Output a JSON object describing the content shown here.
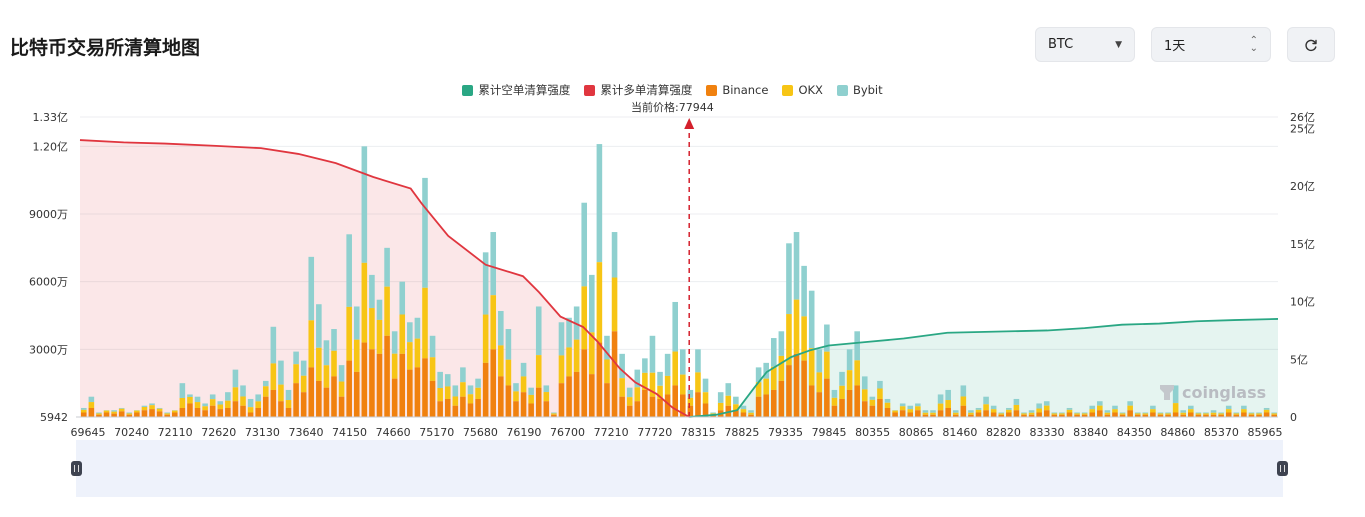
{
  "page": {
    "title": "比特币交易所清算地图",
    "coin_select": "BTC",
    "range_select": "1天",
    "refresh_icon": "refresh-icon"
  },
  "colors": {
    "short_cum": "#2aa784",
    "long_cum": "#e0363f",
    "binance": "#f0810f",
    "okx": "#f7c515",
    "bybit": "#8fd0cf"
  },
  "legend": [
    {
      "key": "short_cum",
      "label": "累计空单清算强度"
    },
    {
      "key": "long_cum",
      "label": "累计多单清算强度"
    },
    {
      "key": "binance",
      "label": "Binance"
    },
    {
      "key": "okx",
      "label": "OKX"
    },
    {
      "key": "bybit",
      "label": "Bybit"
    }
  ],
  "current_price_label": "当前价格:77944",
  "watermark": "coinglass",
  "chart_data": {
    "type": "bar",
    "current_price": 77944,
    "x_range": [
      69645,
      85965
    ],
    "x_ticks": [
      "69645",
      "70240",
      "72110",
      "72620",
      "73130",
      "73640",
      "74150",
      "74660",
      "75170",
      "75680",
      "76190",
      "76700",
      "77210",
      "77720",
      "78315",
      "78825",
      "79335",
      "79845",
      "80355",
      "80865",
      "81460",
      "82820",
      "83330",
      "83840",
      "84350",
      "84860",
      "85370",
      "85965"
    ],
    "y_left_ticks": [
      {
        "label": "5942",
        "value": 0
      },
      {
        "label": "3000万",
        "value": 30000000
      },
      {
        "label": "6000万",
        "value": 60000000
      },
      {
        "label": "9000万",
        "value": 90000000
      },
      {
        "label": "1.20亿",
        "value": 120000000
      },
      {
        "label": "1.33亿",
        "value": 133000000
      }
    ],
    "y_right_ticks": [
      {
        "label": "0",
        "value": 0
      },
      {
        "label": "5亿",
        "value": 500000000
      },
      {
        "label": "10亿",
        "value": 1000000000
      },
      {
        "label": "15亿",
        "value": 1500000000
      },
      {
        "label": "20亿",
        "value": 2000000000
      },
      {
        "label": "25亿",
        "value": 2500000000
      },
      {
        "label": "26亿",
        "value": 2600000000
      }
    ],
    "y_left_range": [
      0,
      133000000
    ],
    "y_right_range": [
      0,
      2600000000
    ],
    "grid": true,
    "legend_position": "top",
    "series_bars": [
      {
        "name": "Binance",
        "values": [
          2000000,
          4000000,
          1000000,
          2000000,
          1500000,
          2500000,
          1000000,
          2000000,
          3000000,
          3500000,
          2500000,
          1000000,
          2000000,
          4000000,
          6000000,
          4000000,
          3000000,
          5000000,
          3500000,
          4000000,
          7000000,
          5000000,
          2000000,
          4000000,
          9000000,
          12000000,
          7000000,
          4000000,
          15000000,
          11000000,
          22000000,
          16000000,
          13000000,
          18000000,
          9000000,
          25000000,
          20000000,
          33000000,
          30000000,
          28000000,
          36000000,
          17000000,
          28000000,
          21000000,
          22000000,
          26000000,
          16000000,
          7000000,
          8000000,
          5000000,
          9000000,
          6000000,
          8000000,
          24000000,
          30000000,
          18000000,
          14000000,
          7000000,
          11000000,
          6000000,
          13000000,
          7000000,
          1000000,
          15000000,
          18000000,
          20000000,
          30000000,
          19000000,
          33000000,
          15000000,
          38000000,
          9000000,
          5000000,
          7000000,
          12000000,
          9000000,
          8000000,
          10000000,
          14000000,
          10000000,
          5000000,
          11000000,
          6000000,
          1000000,
          3000000,
          5000000,
          3000000,
          2000000,
          1000000,
          9000000,
          10000000,
          12000000,
          16000000,
          23000000,
          28000000,
          25000000,
          14000000,
          11000000,
          17000000,
          5000000,
          8000000,
          12000000,
          14000000,
          7000000,
          5000000,
          8000000,
          4000000,
          2000000,
          3000000,
          2000000,
          3000000,
          1000000,
          1000000,
          3000000,
          4000000,
          1000000,
          5000000,
          1000000,
          2000000,
          3000000,
          2000000,
          1000000,
          2000000,
          3000000,
          1000000,
          1000000,
          2000000,
          3000000,
          1000000,
          1000000,
          2000000,
          1000000,
          1000000,
          2000000,
          3000000,
          1000000,
          2000000,
          1000000,
          3000000,
          1000000,
          1000000,
          2000000,
          1000000,
          1000000,
          2000000,
          1000000,
          2000000,
          1000000,
          1000000,
          1000000,
          1000000,
          2000000,
          1000000,
          2000000,
          1000000,
          1000000,
          2000000,
          1000000
        ],
        "okx_frac": 0.28,
        "bybit_values": [
          4000000,
          9000000,
          2000000,
          3000000,
          3000000,
          4000000,
          2000000,
          3000000,
          5000000,
          6000000,
          4000000,
          2000000,
          3000000,
          15000000,
          10000000,
          9000000,
          6000000,
          10000000,
          7000000,
          11000000,
          21000000,
          14000000,
          8000000,
          10000000,
          16000000,
          40000000,
          25000000,
          12000000,
          29000000,
          25000000,
          71000000,
          50000000,
          34000000,
          39000000,
          23000000,
          81000000,
          49000000,
          120000000,
          63000000,
          52000000,
          75000000,
          38000000,
          60000000,
          42000000,
          44000000,
          106000000,
          36000000,
          20000000,
          19000000,
          14000000,
          22000000,
          14000000,
          17000000,
          73000000,
          82000000,
          47000000,
          39000000,
          15000000,
          24000000,
          13000000,
          49000000,
          14000000,
          2000000,
          42000000,
          44000000,
          49000000,
          95000000,
          63000000,
          121000000,
          36000000,
          82000000,
          28000000,
          13000000,
          21000000,
          26000000,
          36000000,
          20000000,
          28000000,
          51000000,
          30000000,
          12000000,
          30000000,
          17000000,
          2000000,
          11000000,
          15000000,
          9000000,
          5000000,
          3000000,
          22000000,
          24000000,
          35000000,
          38000000,
          77000000,
          82000000,
          67000000,
          56000000,
          30000000,
          41000000,
          12000000,
          20000000,
          30000000,
          38000000,
          18000000,
          9000000,
          16000000,
          8000000,
          3000000,
          6000000,
          5000000,
          6000000,
          3000000,
          3000000,
          10000000,
          12000000,
          3000000,
          14000000,
          3000000,
          4000000,
          9000000,
          5000000,
          2000000,
          4000000,
          8000000,
          2000000,
          3000000,
          6000000,
          7000000,
          2000000,
          2000000,
          4000000,
          2000000,
          2000000,
          5000000,
          7000000,
          3000000,
          5000000,
          2000000,
          7000000,
          2000000,
          2000000,
          5000000,
          2000000,
          2000000,
          14000000,
          3000000,
          5000000,
          2000000,
          2000000,
          3000000,
          2000000,
          5000000,
          2000000,
          5000000,
          2000000,
          2000000,
          4000000,
          2000000
        ]
      }
    ],
    "long_cumulative": [
      [
        69645,
        2400000000
      ],
      [
        70240,
        2380000000
      ],
      [
        70800,
        2370000000
      ],
      [
        71500,
        2350000000
      ],
      [
        72110,
        2330000000
      ],
      [
        72620,
        2280000000
      ],
      [
        73130,
        2200000000
      ],
      [
        73640,
        2080000000
      ],
      [
        74150,
        1980000000
      ],
      [
        74300,
        1850000000
      ],
      [
        74660,
        1570000000
      ],
      [
        75170,
        1320000000
      ],
      [
        75680,
        1220000000
      ],
      [
        75900,
        1080000000
      ],
      [
        76190,
        870000000
      ],
      [
        76500,
        780000000
      ],
      [
        76700,
        650000000
      ],
      [
        77000,
        420000000
      ],
      [
        77210,
        300000000
      ],
      [
        77500,
        200000000
      ],
      [
        77720,
        80000000
      ],
      [
        77944,
        0
      ]
    ],
    "short_cumulative": [
      [
        77944,
        0
      ],
      [
        78315,
        20000000
      ],
      [
        78600,
        60000000
      ],
      [
        78825,
        250000000
      ],
      [
        79000,
        390000000
      ],
      [
        79335,
        520000000
      ],
      [
        79600,
        580000000
      ],
      [
        79845,
        620000000
      ],
      [
        80355,
        650000000
      ],
      [
        80865,
        680000000
      ],
      [
        81460,
        730000000
      ],
      [
        82820,
        750000000
      ],
      [
        83330,
        770000000
      ],
      [
        83840,
        800000000
      ],
      [
        84350,
        810000000
      ],
      [
        84860,
        830000000
      ],
      [
        85370,
        840000000
      ],
      [
        85965,
        850000000
      ]
    ]
  }
}
